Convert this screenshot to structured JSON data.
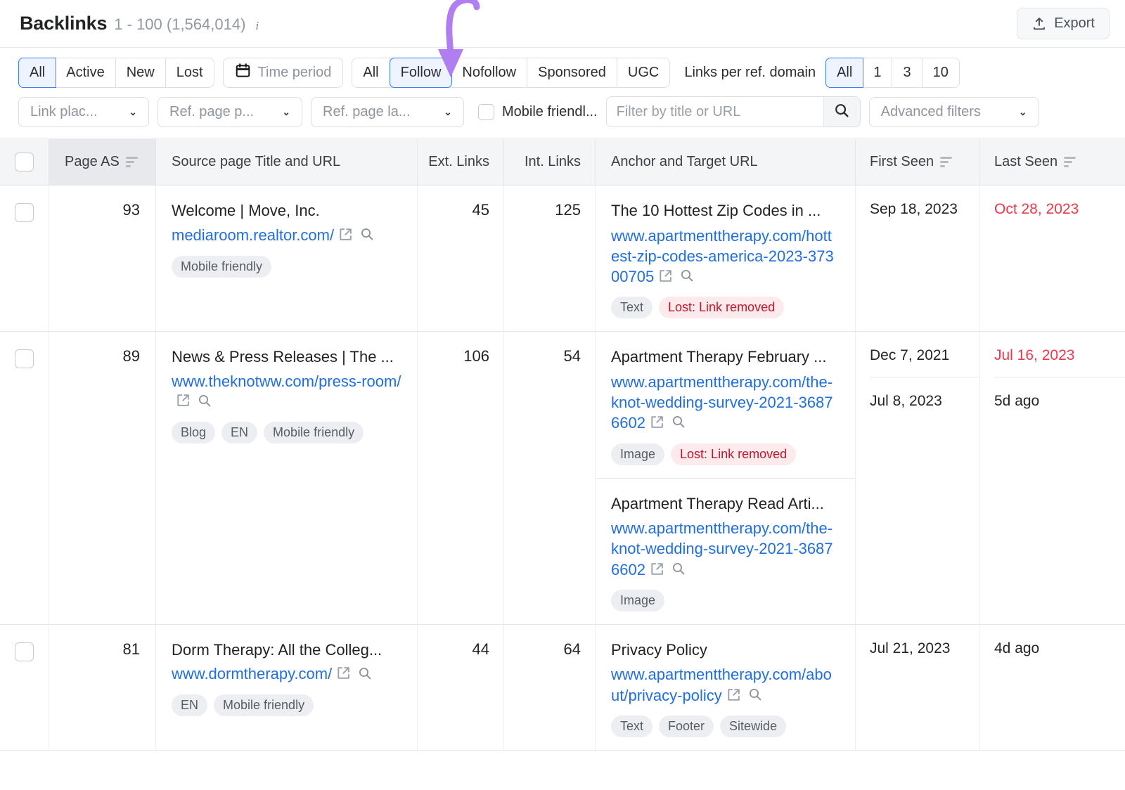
{
  "header": {
    "title": "Backlinks",
    "range": "1 - 100 (1,564,014)",
    "info_icon": "info-icon",
    "export_label": "Export",
    "export_icon": "upload-icon"
  },
  "filters": {
    "status_group": [
      {
        "label": "All",
        "active": true
      },
      {
        "label": "Active",
        "active": false
      },
      {
        "label": "New",
        "active": false
      },
      {
        "label": "Lost",
        "active": false
      }
    ],
    "time_period": {
      "label": "Time period",
      "icon": "calendar-icon"
    },
    "follow_group": [
      {
        "label": "All",
        "active": false
      },
      {
        "label": "Follow",
        "active": true
      },
      {
        "label": "Nofollow",
        "active": false
      },
      {
        "label": "Sponsored",
        "active": false
      },
      {
        "label": "UGC",
        "active": false
      }
    ],
    "links_per_domain_label": "Links per ref. domain",
    "links_per_domain_group": [
      {
        "label": "All",
        "active": true
      },
      {
        "label": "1",
        "active": false
      },
      {
        "label": "3",
        "active": false
      },
      {
        "label": "10",
        "active": false
      }
    ],
    "dropdowns": [
      {
        "label": "Link plac...",
        "name": "link-placement-dropdown"
      },
      {
        "label": "Ref. page p...",
        "name": "ref-page-platform-dropdown"
      },
      {
        "label": "Ref. page la...",
        "name": "ref-page-language-dropdown"
      }
    ],
    "mobile_friendly": {
      "label": "Mobile friendl...",
      "checked": false
    },
    "search": {
      "placeholder": "Filter by title or URL",
      "value": "",
      "icon": "search-icon"
    },
    "advanced": {
      "label": "Advanced filters",
      "icon": "chevron-down-icon"
    }
  },
  "table": {
    "columns": {
      "page_as": "Page AS",
      "source": "Source page Title and URL",
      "ext_links": "Ext. Links",
      "int_links": "Int. Links",
      "anchor": "Anchor and Target URL",
      "first_seen": "First Seen",
      "last_seen": "Last Seen"
    },
    "rows": [
      {
        "page_as": "93",
        "source_title": "Welcome | Move, Inc.",
        "source_url": "mediaroom.realtor.com/",
        "source_tags": [
          "Mobile friendly"
        ],
        "ext_links": "45",
        "int_links": "125",
        "subrows": [
          {
            "anchor_title": "The 10 Hottest Zip Codes in ...",
            "target_url": "www.apartmenttherapy.com/hottest-zip-codes-america-2023-37300705",
            "tags": [
              {
                "text": "Text",
                "lost": false
              },
              {
                "text": "Lost: Link removed",
                "lost": true
              }
            ],
            "first_seen": "Sep 18, 2023",
            "last_seen": "Oct 28, 2023",
            "last_seen_red": true
          }
        ]
      },
      {
        "page_as": "89",
        "source_title": "News & Press Releases | The ...",
        "source_url": "www.theknotww.com/press-room/",
        "source_tags": [
          "Blog",
          "EN",
          "Mobile friendly"
        ],
        "ext_links": "106",
        "int_links": "54",
        "subrows": [
          {
            "anchor_title": "Apartment Therapy February ...",
            "target_url": "www.apartmenttherapy.com/the-knot-wedding-survey-2021-36876602",
            "tags": [
              {
                "text": "Image",
                "lost": false
              },
              {
                "text": "Lost: Link removed",
                "lost": true
              }
            ],
            "first_seen": "Dec 7, 2021",
            "last_seen": "Jul 16, 2023",
            "last_seen_red": true
          },
          {
            "anchor_title": "Apartment Therapy Read Arti...",
            "target_url": "www.apartmenttherapy.com/the-knot-wedding-survey-2021-36876602",
            "tags": [
              {
                "text": "Image",
                "lost": false
              }
            ],
            "first_seen": "Jul 8, 2023",
            "last_seen": "5d ago",
            "last_seen_red": false
          }
        ]
      },
      {
        "page_as": "81",
        "source_title": "Dorm Therapy: All the Colleg...",
        "source_url": "www.dormtherapy.com/",
        "source_tags": [
          "EN",
          "Mobile friendly"
        ],
        "ext_links": "44",
        "int_links": "64",
        "subrows": [
          {
            "anchor_title": "Privacy Policy",
            "target_url": "www.apartmenttherapy.com/about/privacy-policy",
            "tags": [
              {
                "text": "Text",
                "lost": false
              },
              {
                "text": "Footer",
                "lost": false
              },
              {
                "text": "Sitewide",
                "lost": false
              }
            ],
            "first_seen": "Jul 21, 2023",
            "last_seen": "4d ago",
            "last_seen_red": false
          }
        ]
      }
    ]
  },
  "annotation": {
    "type": "curved-arrow",
    "color": "#b07ef0",
    "points_to": "Follow"
  },
  "colors": {
    "accent_blue": "#3b7ff5",
    "link_blue": "#206ee5",
    "red": "#f0374b",
    "tag_bg": "#eceef1",
    "lost_bg": "#fdeaec",
    "lost_text": "#c5152a",
    "header_bg": "#f4f5f7",
    "sorted_header_bg": "#e7e9ec",
    "annotation_purple": "#b07ef0"
  }
}
